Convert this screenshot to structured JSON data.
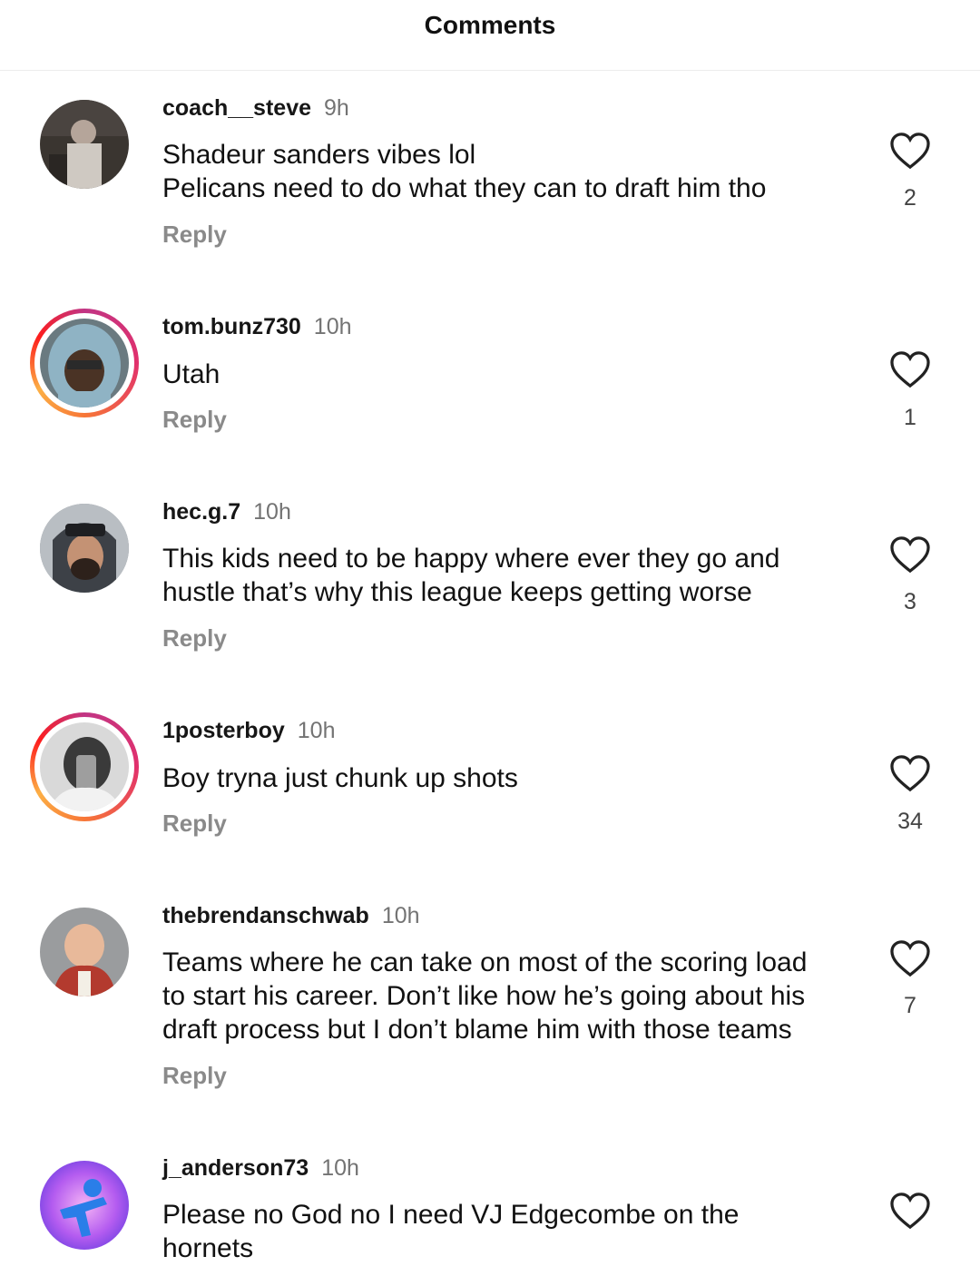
{
  "header": {
    "title": "Comments"
  },
  "comments": [
    {
      "username": "coach__steve",
      "time": "9h",
      "lines": [
        "Shadeur sanders vibes lol",
        "Pelicans need to do what they can to draft him tho"
      ],
      "reply": "Reply",
      "likes": "2",
      "has_story_ring": false
    },
    {
      "username": "tom.bunz730",
      "time": "10h",
      "lines": [
        "Utah"
      ],
      "reply": "Reply",
      "likes": "1",
      "has_story_ring": true
    },
    {
      "username": "hec.g.7",
      "time": "10h",
      "lines": [
        "This kids need to be happy where ever they go and",
        "hustle that’s why this league keeps getting worse"
      ],
      "reply": "Reply",
      "likes": "3",
      "has_story_ring": false
    },
    {
      "username": "1posterboy",
      "time": "10h",
      "lines": [
        "Boy tryna just chunk up shots"
      ],
      "reply": "Reply",
      "likes": "34",
      "has_story_ring": true
    },
    {
      "username": "thebrendanschwab",
      "time": "10h",
      "lines": [
        "Teams where he can take on most of the scoring load",
        "to start his career. Don’t like how he’s going about his",
        "draft process but I don’t blame him with those teams"
      ],
      "reply": "Reply",
      "likes": "7",
      "has_story_ring": false
    },
    {
      "username": "j_anderson73",
      "time": "10h",
      "lines": [
        "Please no God no I need VJ Edgecombe on the",
        "hornets"
      ],
      "reply": "",
      "likes": "",
      "has_story_ring": false
    }
  ],
  "icons": {
    "like": "heart-outline-icon"
  },
  "colors": {
    "username": "#161616",
    "timestamp": "#737373",
    "reply": "#8a8a8a",
    "story_ring": "#e1306c"
  }
}
